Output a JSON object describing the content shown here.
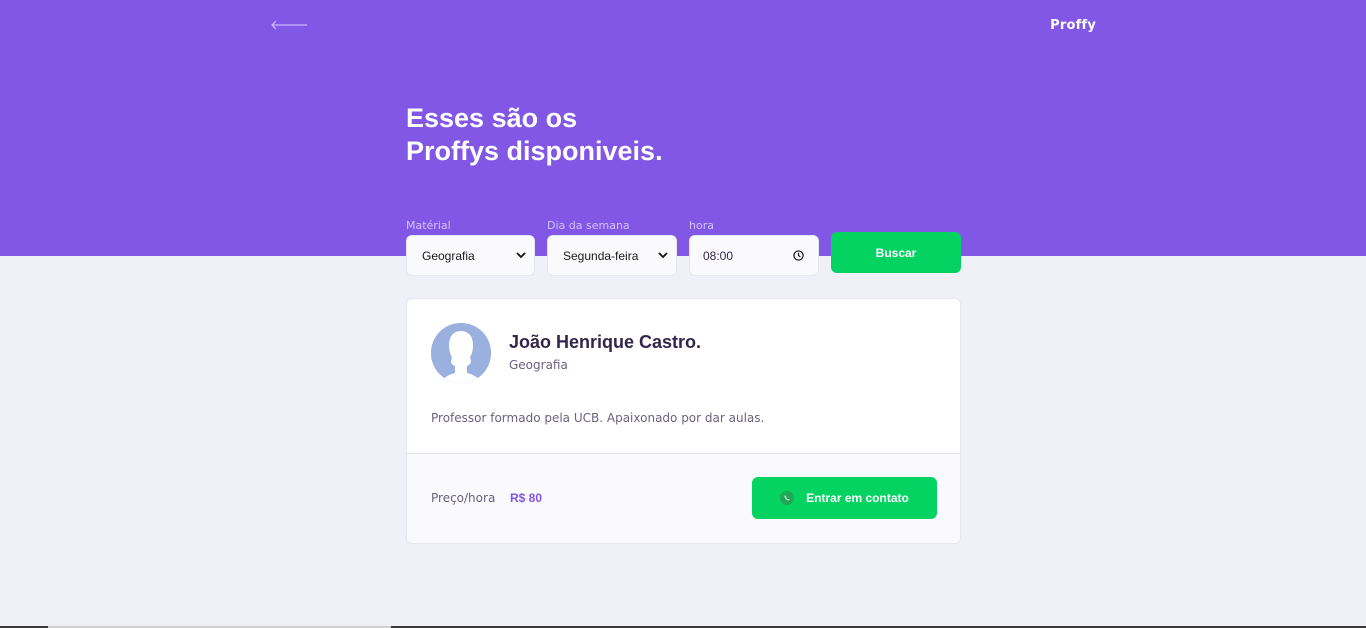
{
  "app": {
    "brand": "Proffy"
  },
  "header": {
    "title_line1": "Esses são os",
    "title_line2": "Proffys disponiveis."
  },
  "filters": {
    "subject": {
      "label": "Matérial",
      "value": "Geografia"
    },
    "weekday": {
      "label": "Dia da semana",
      "value": "Segunda-feira"
    },
    "time": {
      "label": "hora",
      "value": "08:00"
    },
    "search_label": "Buscar"
  },
  "teacher": {
    "name": "João Henrique Castro.",
    "subject": "Geografia",
    "bio": "Professor formado pela UCB. Apaixonado por dar aulas.",
    "price_label": "Preço/hora",
    "price_value": "R$ 80",
    "contact_label": "Entrar em contato"
  },
  "icons": {
    "back": "arrow-left-icon",
    "dropdown": "chevron-down-icon",
    "clock": "clock-icon",
    "whatsapp": "whatsapp-icon",
    "avatar": "user-silhouette"
  },
  "colors": {
    "primary": "#8257e5",
    "secondary": "#04d361",
    "background": "#f0f0f7",
    "text_title": "#32264d",
    "text_base": "#6a6180"
  }
}
